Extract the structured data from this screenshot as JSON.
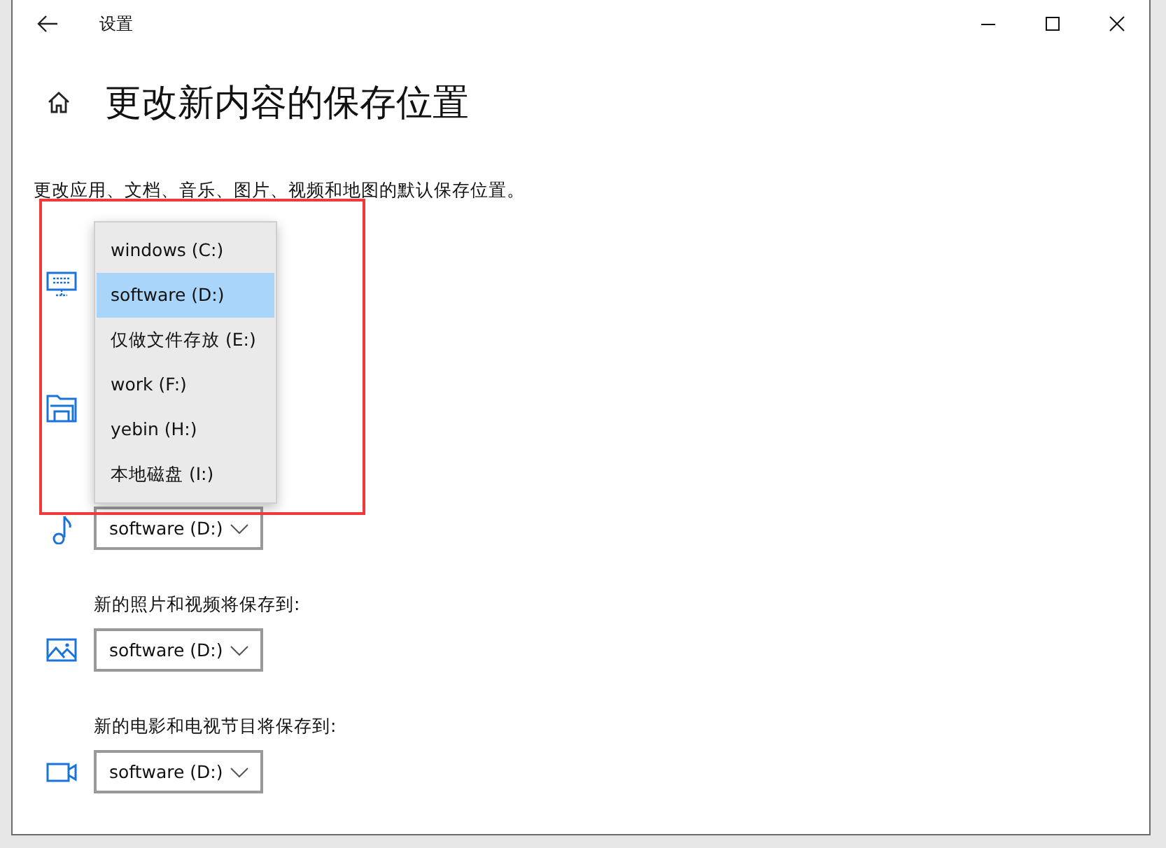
{
  "window": {
    "title": "设置"
  },
  "page": {
    "heading": "更改新内容的保存位置",
    "description": "更改应用、文档、音乐、图片、视频和地图的默认保存位置。"
  },
  "sections": [
    {
      "kind": "apps"
    },
    {
      "kind": "documents"
    },
    {
      "kind": "music",
      "value": "software (D:)"
    },
    {
      "kind": "photos",
      "label": "新的照片和视频将保存到:",
      "value": "software (D:)"
    },
    {
      "kind": "videos",
      "label": "新的电影和电视节目将保存到:",
      "value": "software (D:)"
    }
  ],
  "dropdown_menu": {
    "items": [
      {
        "label": "windows (C:)",
        "selected": false
      },
      {
        "label": "software (D:)",
        "selected": true
      },
      {
        "label": "仅做文件存放 (E:)",
        "selected": false
      },
      {
        "label": "work (F:)",
        "selected": false
      },
      {
        "label": "yebin (H:)",
        "selected": false
      },
      {
        "label": "本地磁盘 (I:)",
        "selected": false
      }
    ]
  },
  "annotation": {
    "kind": "highlight"
  }
}
